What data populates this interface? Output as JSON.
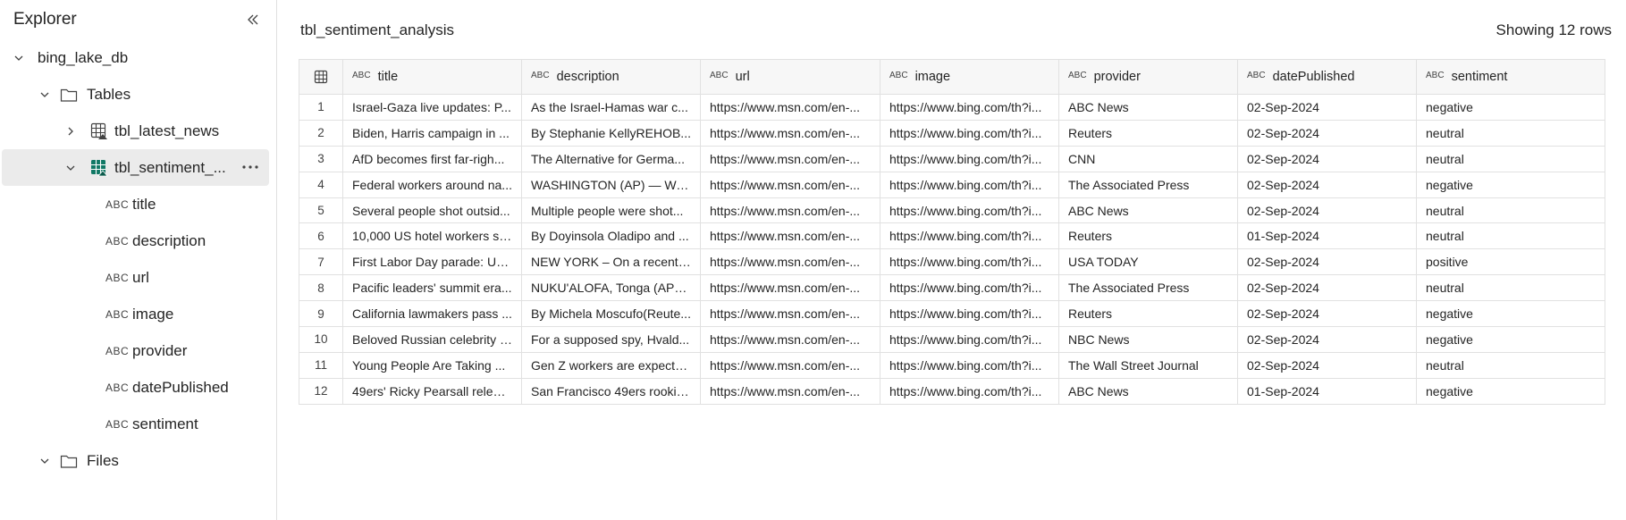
{
  "explorer": {
    "title": "Explorer",
    "tree": {
      "database": "bing_lake_db",
      "tables_folder": "Tables",
      "tables": [
        {
          "name": "tbl_latest_news",
          "expanded": false
        },
        {
          "name": "tbl_sentiment_...",
          "expanded": true,
          "selected": true
        }
      ],
      "columns": [
        {
          "type": "ABC",
          "name": "title"
        },
        {
          "type": "ABC",
          "name": "description"
        },
        {
          "type": "ABC",
          "name": "url"
        },
        {
          "type": "ABC",
          "name": "image"
        },
        {
          "type": "ABC",
          "name": "provider"
        },
        {
          "type": "ABC",
          "name": "datePublished"
        },
        {
          "type": "ABC",
          "name": "sentiment"
        }
      ],
      "files_folder": "Files"
    }
  },
  "main": {
    "table_name": "tbl_sentiment_analysis",
    "row_count_text": "Showing 12 rows",
    "columns": [
      {
        "type": "ABC",
        "name": "title"
      },
      {
        "type": "ABC",
        "name": "description"
      },
      {
        "type": "ABC",
        "name": "url"
      },
      {
        "type": "ABC",
        "name": "image"
      },
      {
        "type": "ABC",
        "name": "provider"
      },
      {
        "type": "ABC",
        "name": "datePublished"
      },
      {
        "type": "ABC",
        "name": "sentiment"
      }
    ],
    "rows": [
      [
        "1",
        "Israel-Gaza live updates: P...",
        "As the Israel-Hamas war c...",
        "https://www.msn.com/en-...",
        "https://www.bing.com/th?i...",
        "ABC News",
        "02-Sep-2024",
        "negative"
      ],
      [
        "2",
        "Biden, Harris campaign in ...",
        "By Stephanie KellyREHOB...",
        "https://www.msn.com/en-...",
        "https://www.bing.com/th?i...",
        "Reuters",
        "02-Sep-2024",
        "neutral"
      ],
      [
        "3",
        "AfD becomes first far-righ...",
        "The Alternative for Germa...",
        "https://www.msn.com/en-...",
        "https://www.bing.com/th?i...",
        "CNN",
        "02-Sep-2024",
        "neutral"
      ],
      [
        "4",
        "Federal workers around na...",
        "WASHINGTON (AP) — Wo...",
        "https://www.msn.com/en-...",
        "https://www.bing.com/th?i...",
        "The Associated Press",
        "02-Sep-2024",
        "negative"
      ],
      [
        "5",
        "Several people shot outsid...",
        "Multiple people were shot...",
        "https://www.msn.com/en-...",
        "https://www.bing.com/th?i...",
        "ABC News",
        "02-Sep-2024",
        "neutral"
      ],
      [
        "6",
        "10,000 US hotel workers st...",
        "By Doyinsola Oladipo and ...",
        "https://www.msn.com/en-...",
        "https://www.bing.com/th?i...",
        "Reuters",
        "01-Sep-2024",
        "neutral"
      ],
      [
        "7",
        "First Labor Day parade: Un...",
        "NEW YORK – On a recent ...",
        "https://www.msn.com/en-...",
        "https://www.bing.com/th?i...",
        "USA TODAY",
        "02-Sep-2024",
        "positive"
      ],
      [
        "8",
        "Pacific leaders' summit era...",
        "NUKU'ALOFA, Tonga (AP) ...",
        "https://www.msn.com/en-...",
        "https://www.bing.com/th?i...",
        "The Associated Press",
        "02-Sep-2024",
        "neutral"
      ],
      [
        "9",
        "California lawmakers pass ...",
        "By Michela Moscufo(Reute...",
        "https://www.msn.com/en-...",
        "https://www.bing.com/th?i...",
        "Reuters",
        "02-Sep-2024",
        "negative"
      ],
      [
        "10",
        "Beloved Russian celebrity '...",
        "For a supposed spy, Hvald...",
        "https://www.msn.com/en-...",
        "https://www.bing.com/th?i...",
        "NBC News",
        "02-Sep-2024",
        "negative"
      ],
      [
        "11",
        "Young People Are Taking ...",
        "Gen Z workers are expecte...",
        "https://www.msn.com/en-...",
        "https://www.bing.com/th?i...",
        "The Wall Street Journal",
        "02-Sep-2024",
        "neutral"
      ],
      [
        "12",
        "49ers' Ricky Pearsall releas...",
        "San Francisco 49ers rookie...",
        "https://www.msn.com/en-...",
        "https://www.bing.com/th?i...",
        "ABC News",
        "01-Sep-2024",
        "negative"
      ]
    ]
  },
  "colors": {
    "table_icon_green": "#117865",
    "selected_bg": "#ebebeb",
    "header_bg": "#f7f7f7",
    "border": "#e1e1e1"
  }
}
